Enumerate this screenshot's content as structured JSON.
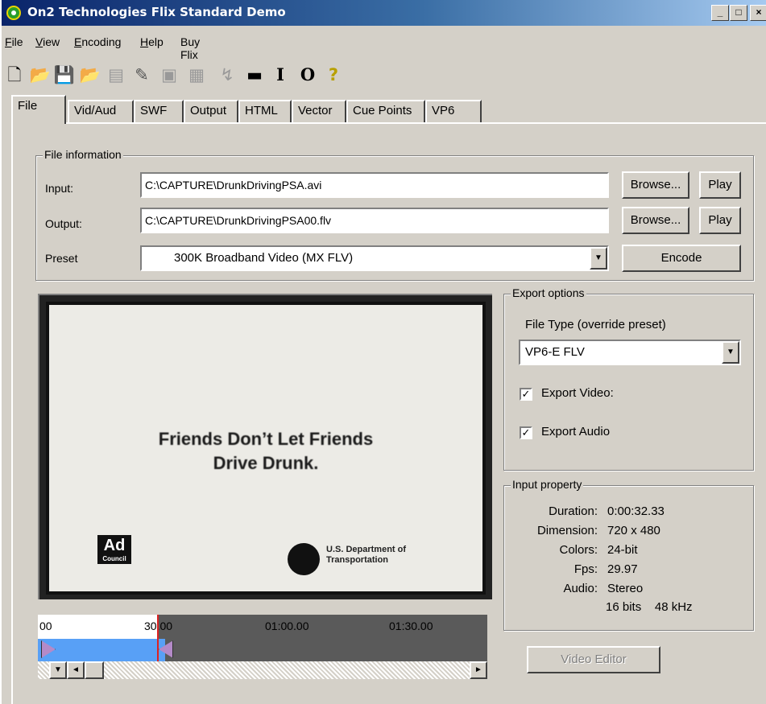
{
  "window": {
    "title": "On2 Technologies Flix Standard Demo",
    "caption_buttons": [
      "_",
      "□",
      "×"
    ]
  },
  "menu": [
    {
      "label": "File",
      "mnemonic": "F",
      "rest": "ile"
    },
    {
      "label": "View",
      "mnemonic": "V",
      "rest": "iew"
    },
    {
      "label": "Encoding",
      "mnemonic": "E",
      "rest": "ncoding"
    },
    {
      "label": "Help",
      "mnemonic": "H",
      "rest": "elp"
    },
    {
      "label": "Buy Flix",
      "mnemonic": "",
      "rest": "Buy Flix"
    }
  ],
  "toolbar": {
    "icons": [
      "new-icon",
      "open-icon",
      "save-icon",
      "open-project-icon",
      "copy-icon",
      "edit-icon",
      "disk-icon",
      "split-icon",
      "convert-icon",
      "batch-icon",
      "mark-in-icon",
      "mark-out-icon",
      "help-icon"
    ],
    "glyphs": [
      "🗋",
      "📂",
      "💾",
      "📂",
      "▤",
      "✎",
      "▣",
      "▦",
      "↯",
      "▬",
      "I",
      "O",
      "?"
    ]
  },
  "tabs": [
    "File",
    "Vid/Aud",
    "SWF",
    "Output",
    "HTML",
    "Vector",
    "Cue Points",
    "VP6"
  ],
  "file_info": {
    "group_label": "File information",
    "input_label": "Input:",
    "input_value": "C:\\CAPTURE\\DrunkDrivingPSA.avi",
    "output_label": "Output:",
    "output_value": "C:\\CAPTURE\\DrunkDrivingPSA00.flv",
    "preset_label": "Preset",
    "preset_value": "300K Broadband Video (MX FLV)",
    "browse_label": "Browse...",
    "play_label": "Play",
    "encode_label": "Encode"
  },
  "preview": {
    "headline_1": "Friends Don’t Let Friends",
    "headline_2": "Drive Drunk.",
    "ad_logo": "Ad",
    "ad_logo_small": "Council",
    "dot_text_1": "U.S. Department of",
    "dot_text_2": "Transportation"
  },
  "timeline": {
    "labels": [
      "00",
      "30.00",
      "01:00.00",
      "01:30.00"
    ],
    "scroll_left": "◄",
    "scroll_right": "►",
    "scroll_down": "▼"
  },
  "export_options": {
    "group_label": "Export options",
    "file_type_label": "File Type (override preset)",
    "file_type_value": "VP6-E FLV",
    "export_video_label": "Export Video:",
    "export_video_checked": true,
    "export_audio_label": "Export Audio",
    "export_audio_checked": true
  },
  "input_property": {
    "group_label": "Input property",
    "rows": [
      {
        "key": "Duration:",
        "value": "0:00:32.33"
      },
      {
        "key": "Dimension:",
        "value": "720 x 480"
      },
      {
        "key": "Colors:",
        "value": "24-bit"
      },
      {
        "key": "Fps:",
        "value": "29.97"
      },
      {
        "key": "Audio:",
        "value": "Stereo"
      }
    ],
    "audio_detail": "16 bits    48 kHz"
  },
  "video_editor_label": "Video Editor"
}
